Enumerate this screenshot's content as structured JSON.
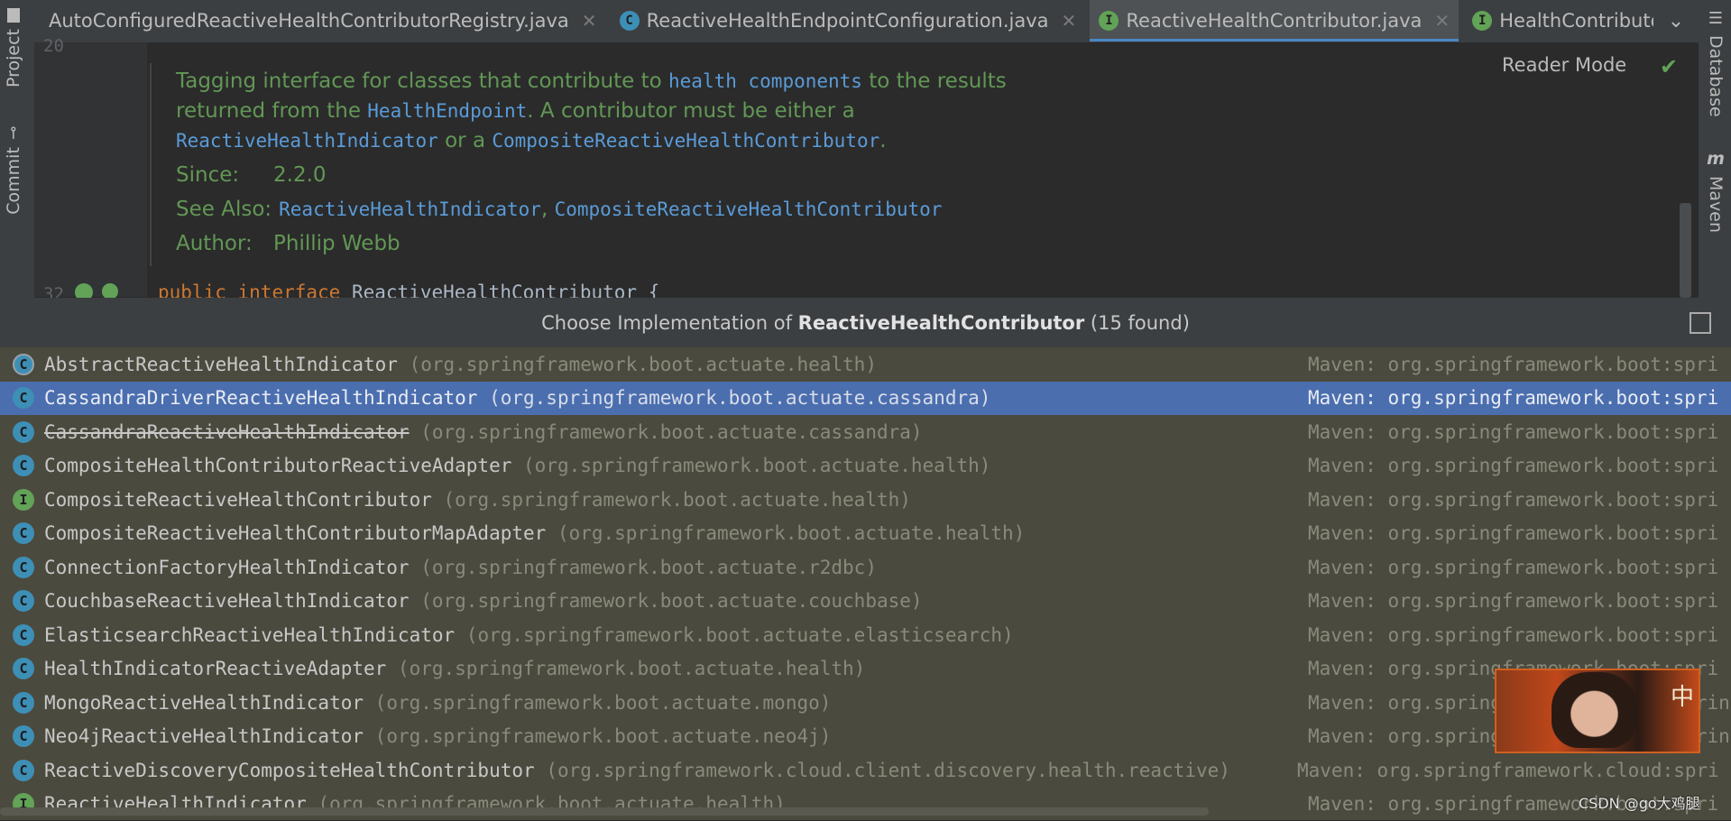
{
  "left_strip": {
    "project_label": "Project",
    "commit_label": "Commit"
  },
  "right_strip": {
    "database_label": "Database",
    "maven_label": "Maven",
    "maven_glyph": "m"
  },
  "tabs": [
    {
      "label": "AutoConfiguredReactiveHealthContributorRegistry.java",
      "icon": "none",
      "closable": true
    },
    {
      "label": "ReactiveHealthEndpointConfiguration.java",
      "icon": "C",
      "closable": true
    },
    {
      "label": "ReactiveHealthContributor.java",
      "icon": "I",
      "closable": true,
      "active": true
    },
    {
      "label": "HealthContributor.jav",
      "icon": "I",
      "closable": false
    }
  ],
  "editor": {
    "line_top": "20",
    "line_bottom": "32",
    "reader_mode": "Reader Mode",
    "doc": {
      "text1": "Tagging interface for classes that contribute to ",
      "link1": "health components",
      "text2": " to the results returned from the ",
      "link2": "HealthEndpoint",
      "text3": ". A contributor must be either a ",
      "link3": "ReactiveHealthIndicator",
      "text4": " or a ",
      "link4": "CompositeReactiveHealthContributor",
      "text5": ".",
      "since_label": "Since:",
      "since_value": "2.2.0",
      "see_also_label": "See Also:",
      "see_also_1": "ReactiveHealthIndicator",
      "see_also_sep": ", ",
      "see_also_2": "CompositeReactiveHealthContributor",
      "author_label": "Author:",
      "author_value": "Phillip Webb"
    },
    "code": {
      "kw1": "public",
      "kw2": "interface",
      "name": "ReactiveHealthContributor",
      "brace": "{"
    }
  },
  "popup": {
    "title_prefix": "Choose Implementation of ",
    "title_bold": "ReactiveHealthContributor",
    "title_suffix": " (15 found)",
    "items": [
      {
        "icon": "C",
        "abstract": true,
        "name": "AbstractReactiveHealthIndicator",
        "pkg": "(org.springframework.boot.actuate.health)",
        "lib": "Maven: org.springframework.boot:spri"
      },
      {
        "icon": "C",
        "name": "CassandraDriverReactiveHealthIndicator",
        "pkg": "(org.springframework.boot.actuate.cassandra)",
        "lib": "Maven: org.springframework.boot:spri",
        "selected": true
      },
      {
        "icon": "C",
        "name": "CassandraReactiveHealthIndicator",
        "pkg": "(org.springframework.boot.actuate.cassandra)",
        "lib": "Maven: org.springframework.boot:spri",
        "deprecated": true
      },
      {
        "icon": "C",
        "name": "CompositeHealthContributorReactiveAdapter",
        "pkg": "(org.springframework.boot.actuate.health)",
        "lib": "Maven: org.springframework.boot:spri"
      },
      {
        "icon": "I",
        "name": "CompositeReactiveHealthContributor",
        "pkg": "(org.springframework.boot.actuate.health)",
        "lib": "Maven: org.springframework.boot:spri"
      },
      {
        "icon": "C",
        "name": "CompositeReactiveHealthContributorMapAdapter",
        "pkg": "(org.springframework.boot.actuate.health)",
        "lib": "Maven: org.springframework.boot:spri"
      },
      {
        "icon": "C",
        "name": "ConnectionFactoryHealthIndicator",
        "pkg": "(org.springframework.boot.actuate.r2dbc)",
        "lib": "Maven: org.springframework.boot:spri"
      },
      {
        "icon": "C",
        "name": "CouchbaseReactiveHealthIndicator",
        "pkg": "(org.springframework.boot.actuate.couchbase)",
        "lib": "Maven: org.springframework.boot:spri"
      },
      {
        "icon": "C",
        "name": "ElasticsearchReactiveHealthIndicator",
        "pkg": "(org.springframework.boot.actuate.elasticsearch)",
        "lib": "Maven: org.springframework.boot:spri"
      },
      {
        "icon": "C",
        "name": "HealthIndicatorReactiveAdapter",
        "pkg": "(org.springframework.boot.actuate.health)",
        "lib": "Maven: org.springframework.boot:spri"
      },
      {
        "icon": "C",
        "name": "MongoReactiveHealthIndicator",
        "pkg": "(org.springframework.boot.actuate.mongo)",
        "lib": "Maven: org.springframework.boot:sprin"
      },
      {
        "icon": "C",
        "name": "Neo4jReactiveHealthIndicator",
        "pkg": "(org.springframework.boot.actuate.neo4j)",
        "lib": "Maven: org.springframework.boot:sprin"
      },
      {
        "icon": "C",
        "name": "ReactiveDiscoveryCompositeHealthContributor",
        "pkg": "(org.springframework.cloud.client.discovery.health.reactive)",
        "lib": "Maven: org.springframework.cloud:spri"
      },
      {
        "icon": "I",
        "name": "ReactiveHealthIndicator",
        "pkg": "(org.springframework.boot.actuate.health)",
        "lib": "Maven: org.springframework.boot:spri"
      }
    ]
  },
  "overlay": {
    "avatar_char": "中",
    "watermark": "CSDN @go大鸡腿"
  },
  "colors": {
    "selected_row": "#4b6eaf",
    "popup_bg": "#4b4a3e",
    "class_icon": "#3d8fb6",
    "interface_icon": "#62a357",
    "doc_text": "#629755",
    "doc_link": "#5a9bd8"
  }
}
